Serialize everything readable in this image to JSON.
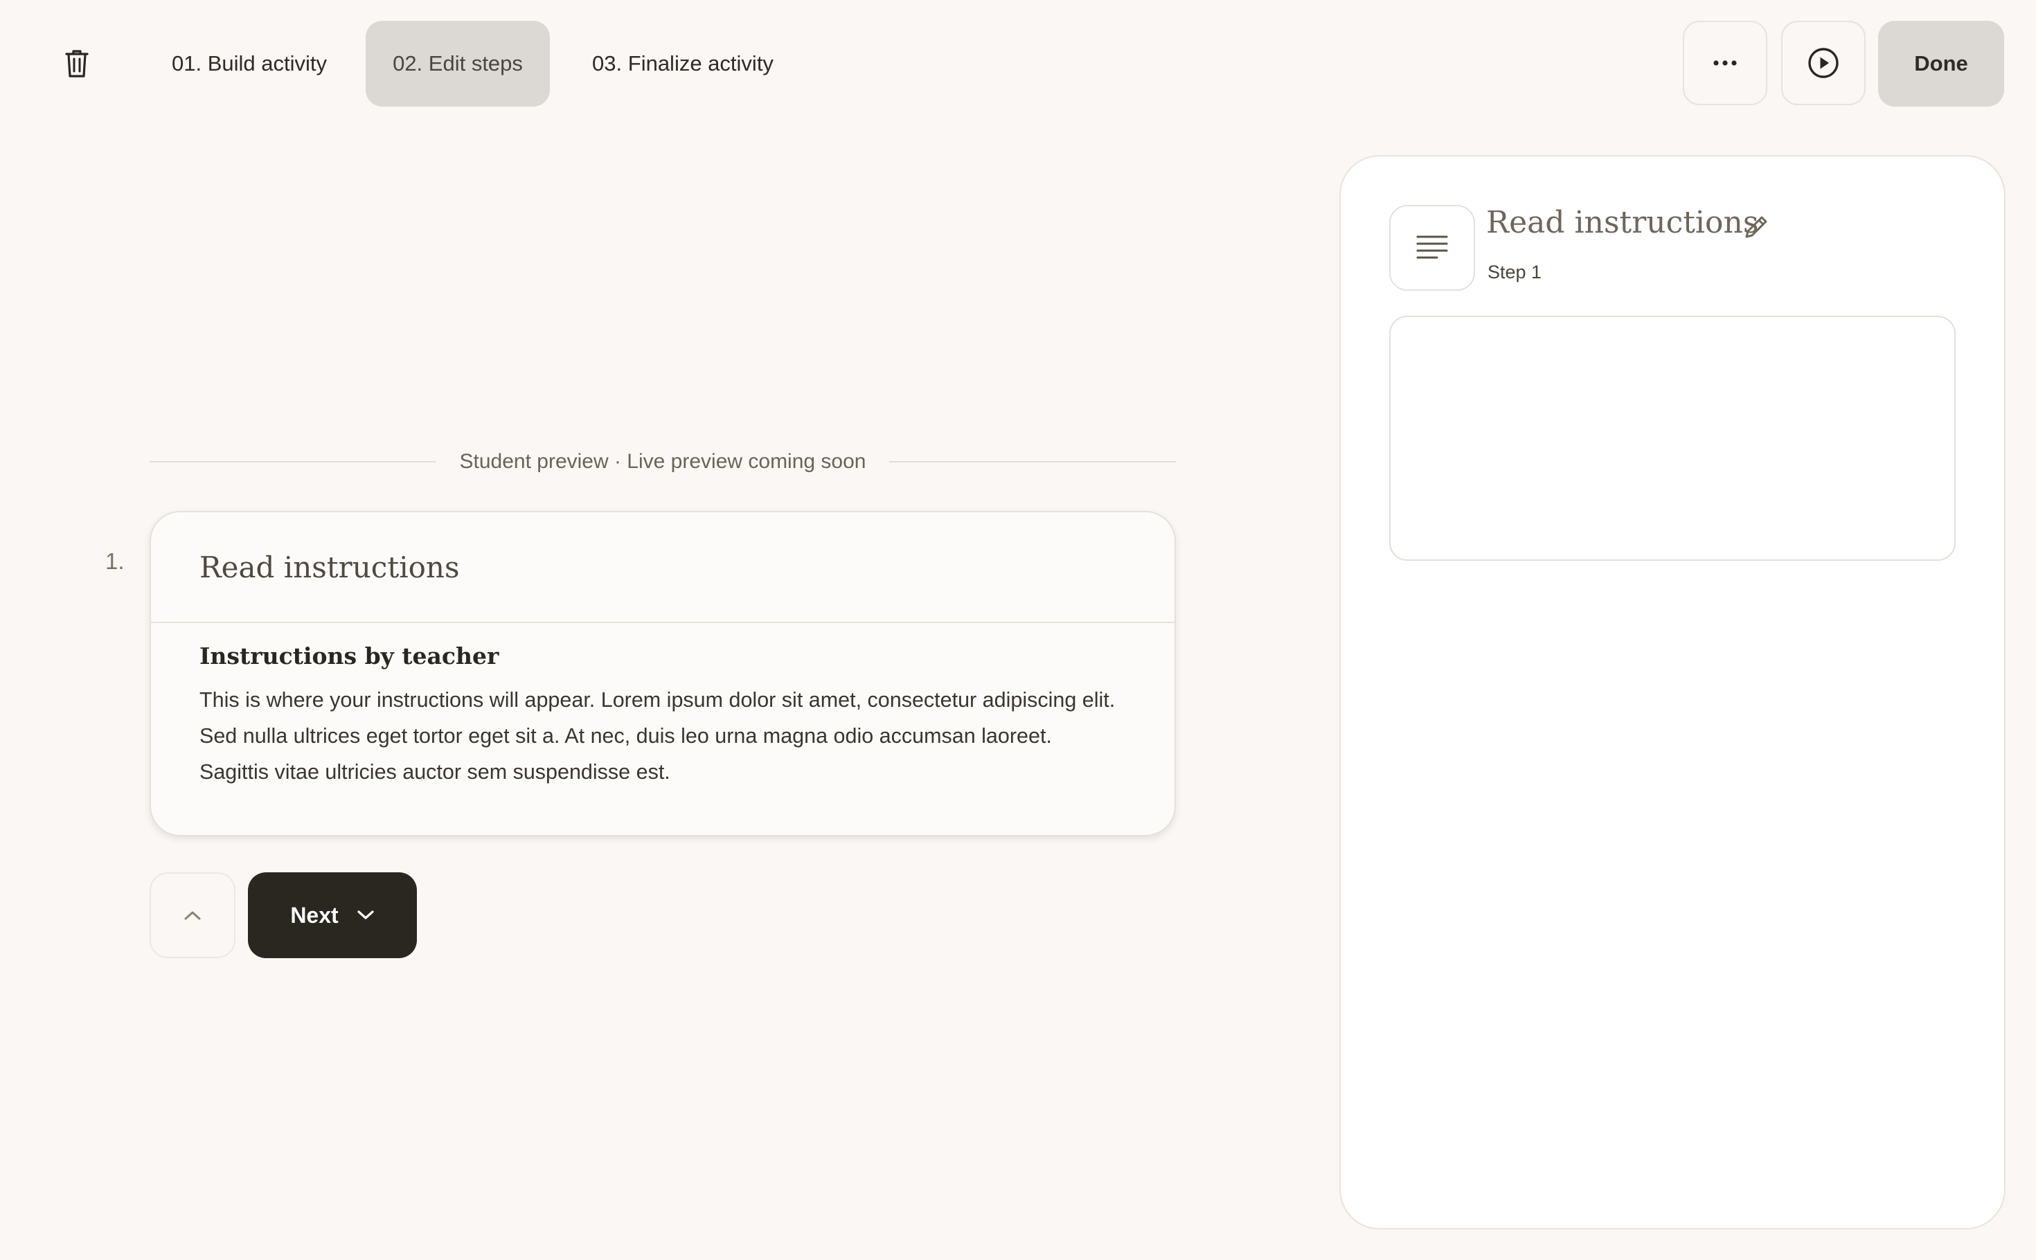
{
  "toolbar": {
    "tabs": [
      {
        "label": "01. Build activity",
        "active": false
      },
      {
        "label": "02. Edit steps",
        "active": true
      },
      {
        "label": "03. Finalize activity",
        "active": false
      }
    ],
    "done_label": "Done",
    "icons": {
      "delete": "trash-icon",
      "more": "more-horizontal-icon",
      "preview": "play-circle-icon"
    }
  },
  "preview": {
    "divider_label": "Student preview · Live preview coming soon",
    "step_number": "1.",
    "card": {
      "title": "Read instructions",
      "body_title": "Instructions by teacher",
      "body_text": "This is where your instructions will appear. Lorem ipsum dolor sit amet, consectetur adipiscing elit. Sed nulla ultrices eget tortor eget sit a. At nec, duis leo urna magna odio accumsan laoreet. Sagittis vitae ultricies auctor sem suspendisse est."
    },
    "nav": {
      "next_label": "Next",
      "prev_icon": "chevron-up-icon",
      "next_icon": "chevron-down-icon"
    }
  },
  "panel": {
    "title": "Read instructions",
    "subtitle": "Step 1",
    "step_icon": "text-lines-icon",
    "edit_icon": "pencil-icon",
    "textarea_value": ""
  },
  "colors": {
    "background": "#faf7f4",
    "active_tab": "#dcd8d4",
    "primary_button": "#2a2620",
    "muted_text": "#6b6358"
  }
}
